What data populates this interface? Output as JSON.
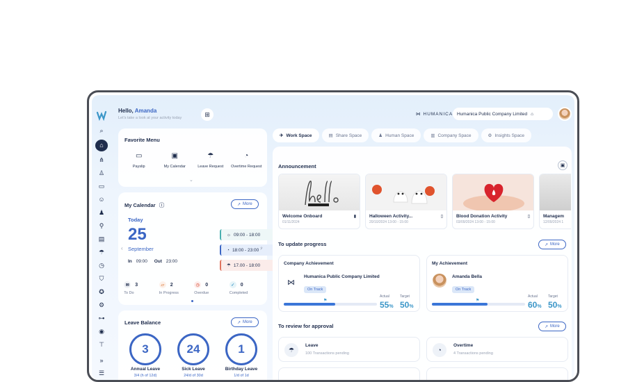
{
  "header": {
    "greeting": "Hello,",
    "user": "Amanda",
    "subtitle": "Let's take a look at your activity today"
  },
  "brand": {
    "name": "HUMANICA",
    "company": "Humanica Public Company Limited"
  },
  "favorite": {
    "title": "Favorite Menu",
    "items": [
      {
        "label": "Payslip",
        "icon": "payslip-icon"
      },
      {
        "label": "My Calendar",
        "icon": "calendar-icon"
      },
      {
        "label": "Leave Request",
        "icon": "beach-icon"
      },
      {
        "label": "Overtime Request",
        "icon": "overtime-icon"
      }
    ]
  },
  "calendar": {
    "title": "My Calendar",
    "more": "More",
    "today": "Today",
    "day": "25",
    "month": "September",
    "in_label": "In",
    "in_time": "09:00",
    "out_label": "Out",
    "out_time": "23:00",
    "slots": [
      "09:00 - 18:00",
      "18:00 - 23:00",
      "17.00 - 18:00"
    ],
    "stats": [
      {
        "count": "3",
        "label": "To Do"
      },
      {
        "count": "2",
        "label": "In Progress"
      },
      {
        "count": "0",
        "label": "Overdue"
      },
      {
        "count": "0",
        "label": "Completed"
      }
    ]
  },
  "leave": {
    "title": "Leave Balance",
    "more": "More",
    "items": [
      {
        "value": "3",
        "label": "Annual Leave",
        "sub": "3/4 (h of 12d)"
      },
      {
        "value": "24",
        "label": "Sick Leave",
        "sub": "24/d of 30d"
      },
      {
        "value": "1",
        "label": "Birthday Leave",
        "sub": "1/d of 1d"
      }
    ]
  },
  "tabs": [
    {
      "label": "Work Space",
      "icon": "rocket-icon"
    },
    {
      "label": "Share Space",
      "icon": "share-icon"
    },
    {
      "label": "Human Space",
      "icon": "people-icon"
    },
    {
      "label": "Company Space",
      "icon": "building-icon"
    },
    {
      "label": "Insights Space",
      "icon": "insights-icon"
    }
  ],
  "announcement": {
    "title": "Announcement",
    "items": [
      {
        "title": "Welcome Onboard",
        "date": "01/11/2024"
      },
      {
        "title": "Halloween Activity...",
        "date": "20/10/2024 13:00 - 15:00"
      },
      {
        "title": "Blood Donation Activity",
        "date": "03/09/2024 13:00 - 15:00"
      },
      {
        "title": "Managem",
        "date": "12/09/2024 1"
      }
    ]
  },
  "progress": {
    "title": "To update progress",
    "more": "More",
    "company": {
      "heading": "Company Achievement",
      "name": "Humanica Public Company Limited",
      "status": "On Track",
      "actual_label": "Actual",
      "target_label": "Target",
      "actual": "55",
      "target": "50",
      "unit": "%",
      "fill": 0.55
    },
    "mine": {
      "heading": "My Achievement",
      "name": "Amanda Bella",
      "status": "On Track",
      "actual_label": "Actual",
      "target_label": "Target",
      "actual": "60",
      "target": "50",
      "unit": "%",
      "fill": 0.6
    }
  },
  "approval": {
    "title": "To review for approval",
    "more": "More",
    "items": [
      {
        "title": "Leave",
        "desc": "100 Transactions pending"
      },
      {
        "title": "Overtime",
        "desc": "4 Transactions pending"
      }
    ]
  },
  "colors": {
    "accent": "#3b66c4",
    "navy": "#1f2d4d",
    "teal": "#3b96c8"
  }
}
